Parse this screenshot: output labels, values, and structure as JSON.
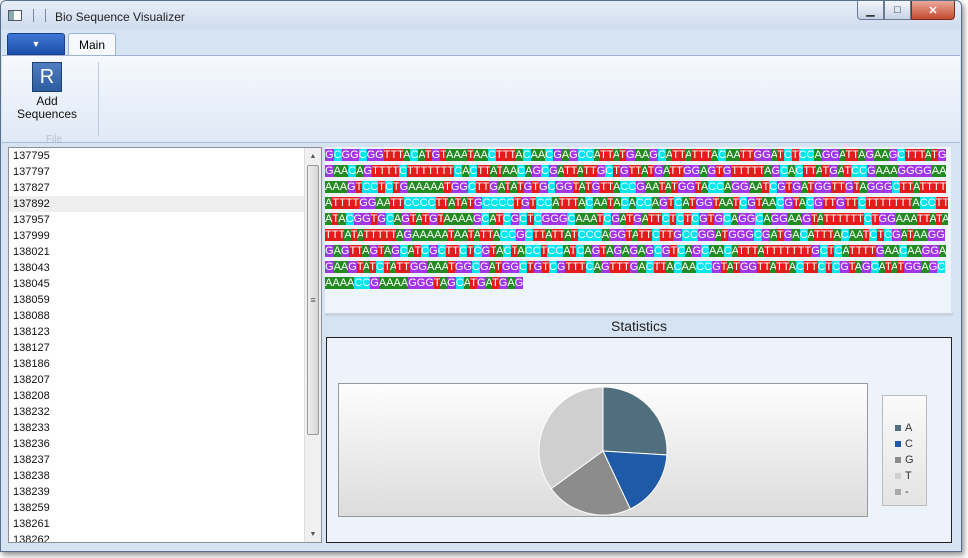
{
  "window": {
    "title": "Bio Sequence Visualizer",
    "min_glyph": "▁",
    "max_glyph": "□",
    "close_glyph": "✕"
  },
  "ribbon": {
    "app_menu_glyph": "▼",
    "tabs": [
      {
        "label": "Main"
      }
    ],
    "buttons": [
      {
        "icon_letter": "R",
        "label_line1": "Add",
        "label_line2": "Sequences"
      }
    ],
    "group_label": "File"
  },
  "sequence_list": {
    "items": [
      "137795",
      "137797",
      "137827",
      "137892",
      "137957",
      "137999",
      "138021",
      "138043",
      "138045",
      "138059",
      "138088",
      "138123",
      "138127",
      "138186",
      "138207",
      "138208",
      "138232",
      "138233",
      "138236",
      "138237",
      "138238",
      "138239",
      "138259",
      "138261",
      "138262"
    ],
    "selected_index": 3,
    "scroll_up_glyph": "▲",
    "scroll_down_glyph": "▼",
    "thumb_glyph": "≡"
  },
  "sequence": {
    "text": "GCGGCGGTTTACATGTAAATAACTTTACAACGAGCCATTATGAAGCATTATTTACAATTGGATCTCCAGGATTAGAAGCTTTATGGAACAGTTTTCTTTTTTTCACTTATAACAGCGATTATTGCTGTTATGATTGGAGTGTTTTTAGCACTTATGATCCGAAAGGGGAAAAAGTCCTCTGAAAAATGGCTTGATATGTGCGGTATGTTACCGAATATGGTACCAGGAATCGTGATGGTTGTAGGGCTTATTTTATTTTGGAATTCCCCTTATATGCCCCTGTCCATTTACAATACACCAGTCATGGTAATCGTAACGTACGTTGTTCTTTTTTTACCTTATACGGTGCAGTATGTAAAAGCATCGCTCGGGCAAATCGATGATTCTCTCGTGCAGGCAGGAAGTATTTTTTCTGGAAATTATATTTATATTTTTAGAAAAATAATATTACCGCTTATTATCCCAGGTATTCTTGCCGGATGGGCGATGACATTTACAATCTCGATAAGGGAGTTAGTAGCATCGCTTCTCGTACTACCTCCATCAGTAGAGAGCGTCAGCAACATTTATTTTTTTGCTCATTTTGAACAAGGAGAAGTATCTATTGGAAATGGCGATGGCTGTCGTTTCAGTTTGACTTACAACCGTATGGTTATTACTTCTCGTAGCATATGGAGCAAAACCGAAAAGGGTAGCATGATGAG"
  },
  "statistics": {
    "title": "Statistics"
  },
  "chart_data": {
    "type": "pie",
    "title": "",
    "categories": [
      "A",
      "C",
      "G",
      "T",
      "-"
    ],
    "values": [
      26,
      17,
      22,
      35,
      0
    ],
    "colors": [
      "#4f6f7f",
      "#1f5aa6",
      "#8c8c8c",
      "#cfcfcf",
      "#a8a8a8"
    ],
    "legend_placement": "right"
  }
}
